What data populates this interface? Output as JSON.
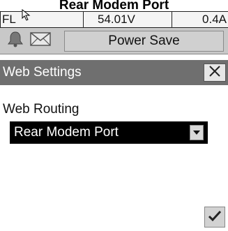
{
  "caption": "Rear Modem Port",
  "status_bar": {
    "mode": "FL",
    "voltage": "54.01V",
    "current": "0.4A"
  },
  "toolbar": {
    "icons": [
      "bell-icon",
      "envelope-icon"
    ],
    "power_save_label": "Power Save"
  },
  "panel": {
    "title": "Web Settings",
    "close_icon": "close-icon"
  },
  "form": {
    "field_label": "Web Routing",
    "selected_value": "Rear Modem Port",
    "dropdown_icon": "chevron-down-icon"
  },
  "footer": {
    "confirm_icon": "checkmark-icon"
  }
}
